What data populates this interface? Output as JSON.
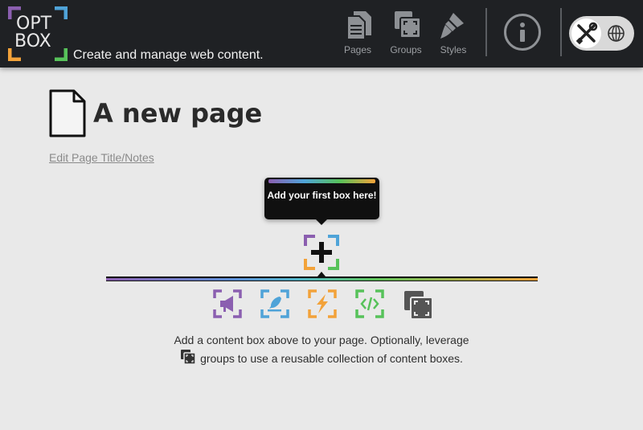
{
  "brand": {
    "logo_line1": "OPT",
    "logo_line2": "BOX",
    "tagline": "Create and manage web content."
  },
  "nav": {
    "pages_label": "Pages",
    "groups_label": "Groups",
    "styles_label": "Styles"
  },
  "colors": {
    "topbar": "#1f2124",
    "purple": "#8b5fb0",
    "blue": "#4fa3d8",
    "orange": "#f2a23a",
    "green": "#57c25a",
    "dark": "#555555"
  },
  "page": {
    "title": "A new page",
    "edit_link": "Edit Page Title/Notes"
  },
  "tooltip": {
    "text": "Add your first box here!"
  },
  "box_types": [
    {
      "name": "announcement-box",
      "icon": "megaphone-icon"
    },
    {
      "name": "text-box",
      "icon": "feather-icon"
    },
    {
      "name": "dynamic-box",
      "icon": "lightning-icon"
    },
    {
      "name": "code-box",
      "icon": "code-icon"
    },
    {
      "name": "group-box",
      "icon": "groups-icon"
    }
  ],
  "help": {
    "line1": "Add a content box above to your page. Optionally, leverage",
    "line2": "groups to use a reusable collection of content boxes."
  }
}
